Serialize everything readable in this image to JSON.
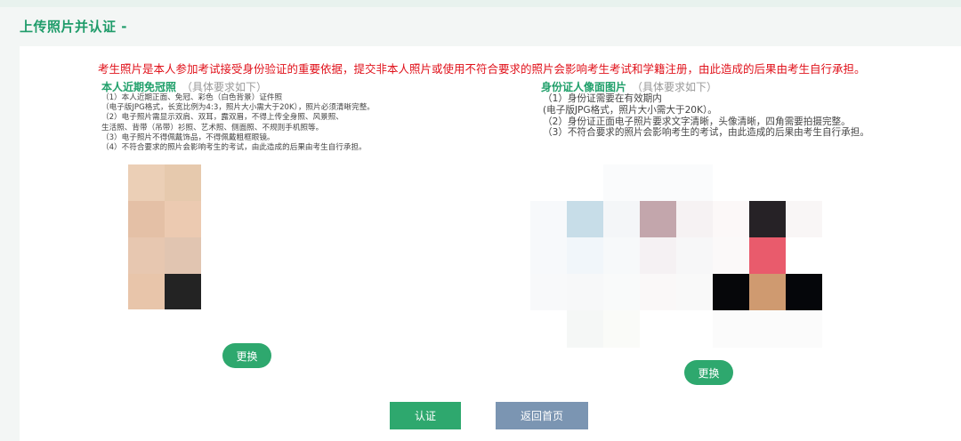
{
  "page_title": "上传照片并认证 -",
  "warning": "考生照片是本人参加考试接受身份验证的重要依据，提交非本人照片或使用不符合要求的照片会影响考生考试和学籍注册，由此造成的后果由考生自行承担。",
  "left_section": {
    "title": "本人近期免冠照",
    "note": "（具体要求如下）",
    "requirements": [
      "（1）本人近期正面、免冠、彩色（白色背景）证件照",
      "（电子版JPG格式，长宽比例为4:3，照片大小需大于20K），照片必须清晰完整。",
      "（2）电子照片需显示双肩、双耳，露双眉，不得上传全身照、风景照、",
      "生活照、背带（吊带）衫照、艺术照、侧面照、不规则手机照等。",
      "（3）电子照片不得佩戴饰品，不得佩戴粗框眼镜。",
      "（4）不符合要求的照片会影响考生的考试，由此造成的后果由考生自行承担。"
    ],
    "change_label": "更换"
  },
  "right_section": {
    "title": "身份证人像面图片",
    "note": "（具体要求如下）",
    "requirements": [
      "（1）身份证需要在有效期内",
      "(电子版JPG格式，照片大小需大于20K）。",
      "（2）身份证正面电子照片要求文字清晰，头像清晰，四角需要拍摄完整。",
      "（3）不符合要求的照片会影响考生的考试，由此造成的后果由考生自行承担。"
    ],
    "change_label": "更换"
  },
  "actions": {
    "confirm_label": "认证",
    "home_label": "返回首页"
  },
  "colors": {
    "brand_green": "#2ea86e",
    "title_green": "#1f9c6a",
    "warning_red": "#e0121b",
    "secondary_button": "#7b95b2"
  }
}
